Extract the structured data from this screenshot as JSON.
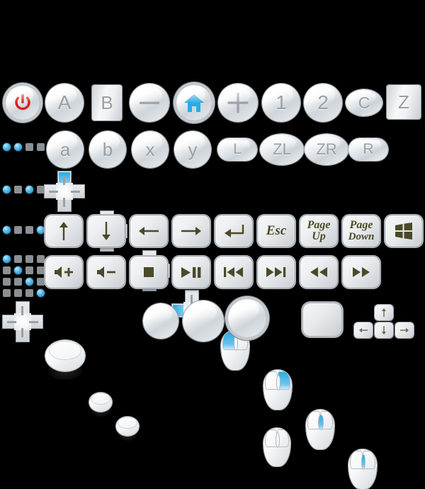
{
  "sheet": {
    "title": "Game controller and keyboard button icon sheet",
    "background_color": "#000000",
    "accent_blue": "#29ABE2",
    "power_red": "#D91E18",
    "glyph_olive": "#4A4A28",
    "label_gray": "#9A9FA3"
  },
  "rows": [
    {
      "name": "row-primary-buttons",
      "items": [
        {
          "name": "power-button",
          "label": "",
          "icon": "power-icon",
          "shape": "circle-ring"
        },
        {
          "name": "button-a",
          "label": "A",
          "icon": "",
          "shape": "circle"
        },
        {
          "name": "button-b-square",
          "label": "B",
          "icon": "",
          "shape": "square"
        },
        {
          "name": "button-minus",
          "label": "",
          "icon": "minus-icon",
          "shape": "circle"
        },
        {
          "name": "button-home",
          "label": "",
          "icon": "home-icon",
          "shape": "circle-ring"
        },
        {
          "name": "button-plus",
          "label": "",
          "icon": "plus-icon",
          "shape": "circle"
        },
        {
          "name": "button-1",
          "label": "1",
          "icon": "",
          "shape": "circle"
        },
        {
          "name": "button-2",
          "label": "2",
          "icon": "",
          "shape": "circle"
        },
        {
          "name": "button-c",
          "label": "C",
          "icon": "",
          "shape": "ellipse"
        },
        {
          "name": "button-z-square",
          "label": "Z",
          "icon": "",
          "shape": "square"
        }
      ]
    },
    {
      "name": "row-secondary-buttons",
      "indicator": {
        "name": "indicator-row-2",
        "pattern": [
          "b",
          "b",
          "g",
          "g"
        ]
      },
      "items": [
        {
          "name": "button-a-lower",
          "label": "a",
          "shape": "circle"
        },
        {
          "name": "button-b-lower",
          "label": "b",
          "shape": "circle"
        },
        {
          "name": "button-x-lower",
          "label": "x",
          "shape": "circle"
        },
        {
          "name": "button-y-lower",
          "label": "y",
          "shape": "circle"
        },
        {
          "name": "shoulder-l",
          "label": "L",
          "shape": "pill"
        },
        {
          "name": "shoulder-zl",
          "label": "ZL",
          "shape": "ellipse"
        },
        {
          "name": "shoulder-zr",
          "label": "ZR",
          "shape": "ellipse"
        },
        {
          "name": "shoulder-r",
          "label": "R",
          "shape": "pill"
        }
      ]
    },
    {
      "name": "row-dpad-and-mouse",
      "indicator": {
        "name": "indicator-row-3",
        "pattern": [
          "b",
          "g",
          "b",
          "g"
        ]
      },
      "items": [
        {
          "name": "dpad-up",
          "direction": "up"
        },
        {
          "name": "dpad-right",
          "direction": "right"
        },
        {
          "name": "dpad-down",
          "direction": "down"
        },
        {
          "name": "dpad-left",
          "direction": "left"
        },
        {
          "name": "mouse-left-click",
          "highlight": "left"
        },
        {
          "name": "mouse-right-click",
          "highlight": "right"
        },
        {
          "name": "mouse-scroll-wheel",
          "highlight": "wheel"
        },
        {
          "name": "mouse-middle-click",
          "highlight": "wheel-narrow"
        }
      ]
    },
    {
      "name": "row-arrow-and-named-keys",
      "indicator": {
        "name": "indicator-row-4",
        "pattern": [
          "b",
          "g",
          "g",
          "b"
        ]
      },
      "items": [
        {
          "name": "key-arrow-up",
          "label": "",
          "icon": "arrow-up-icon"
        },
        {
          "name": "key-arrow-down",
          "label": "",
          "icon": "arrow-down-icon"
        },
        {
          "name": "key-arrow-left",
          "label": "",
          "icon": "arrow-left-icon"
        },
        {
          "name": "key-arrow-right",
          "label": "",
          "icon": "arrow-right-icon"
        },
        {
          "name": "key-enter",
          "label": "",
          "icon": "enter-return-icon"
        },
        {
          "name": "key-escape",
          "label": "Esc",
          "icon": ""
        },
        {
          "name": "key-page-up",
          "label": "Page\nUp",
          "line1": "Page",
          "line2": "Up",
          "icon": ""
        },
        {
          "name": "key-page-down",
          "label": "Page\nDown",
          "line1": "Page",
          "line2": "Down",
          "icon": ""
        },
        {
          "name": "key-windows",
          "label": "",
          "icon": "windows-logo-icon"
        }
      ]
    },
    {
      "name": "row-media-keys",
      "indicator": {
        "name": "indicator-grid-row-5",
        "grid": 4,
        "blue_diagonal": true
      },
      "items": [
        {
          "name": "key-volume-up",
          "icon": "volume-up-icon"
        },
        {
          "name": "key-volume-down",
          "icon": "volume-down-icon"
        },
        {
          "name": "key-stop",
          "icon": "stop-icon"
        },
        {
          "name": "key-play-pause",
          "icon": "play-pause-icon"
        },
        {
          "name": "key-previous-track",
          "icon": "previous-track-icon"
        },
        {
          "name": "key-next-track",
          "icon": "next-track-icon"
        },
        {
          "name": "key-rewind",
          "icon": "rewind-icon"
        },
        {
          "name": "key-fast-forward",
          "icon": "fast-forward-icon"
        }
      ]
    },
    {
      "name": "row-blank-controls",
      "items": [
        {
          "name": "dpad-plain",
          "type": "dpad"
        },
        {
          "name": "analog-stick-large",
          "type": "stick"
        },
        {
          "name": "analog-stick-small-1",
          "type": "stick"
        },
        {
          "name": "analog-stick-small-2",
          "type": "stick"
        },
        {
          "name": "button-blank-circle-1",
          "type": "circle"
        },
        {
          "name": "button-blank-circle-2",
          "type": "circle"
        },
        {
          "name": "button-blank-circle-3",
          "type": "circle"
        },
        {
          "name": "mouse-plain",
          "type": "mouse"
        },
        {
          "name": "key-blank-square",
          "type": "square"
        },
        {
          "name": "arrow-key-cluster",
          "type": "cluster",
          "keys": [
            "up",
            "left",
            "down",
            "right"
          ]
        }
      ]
    }
  ]
}
